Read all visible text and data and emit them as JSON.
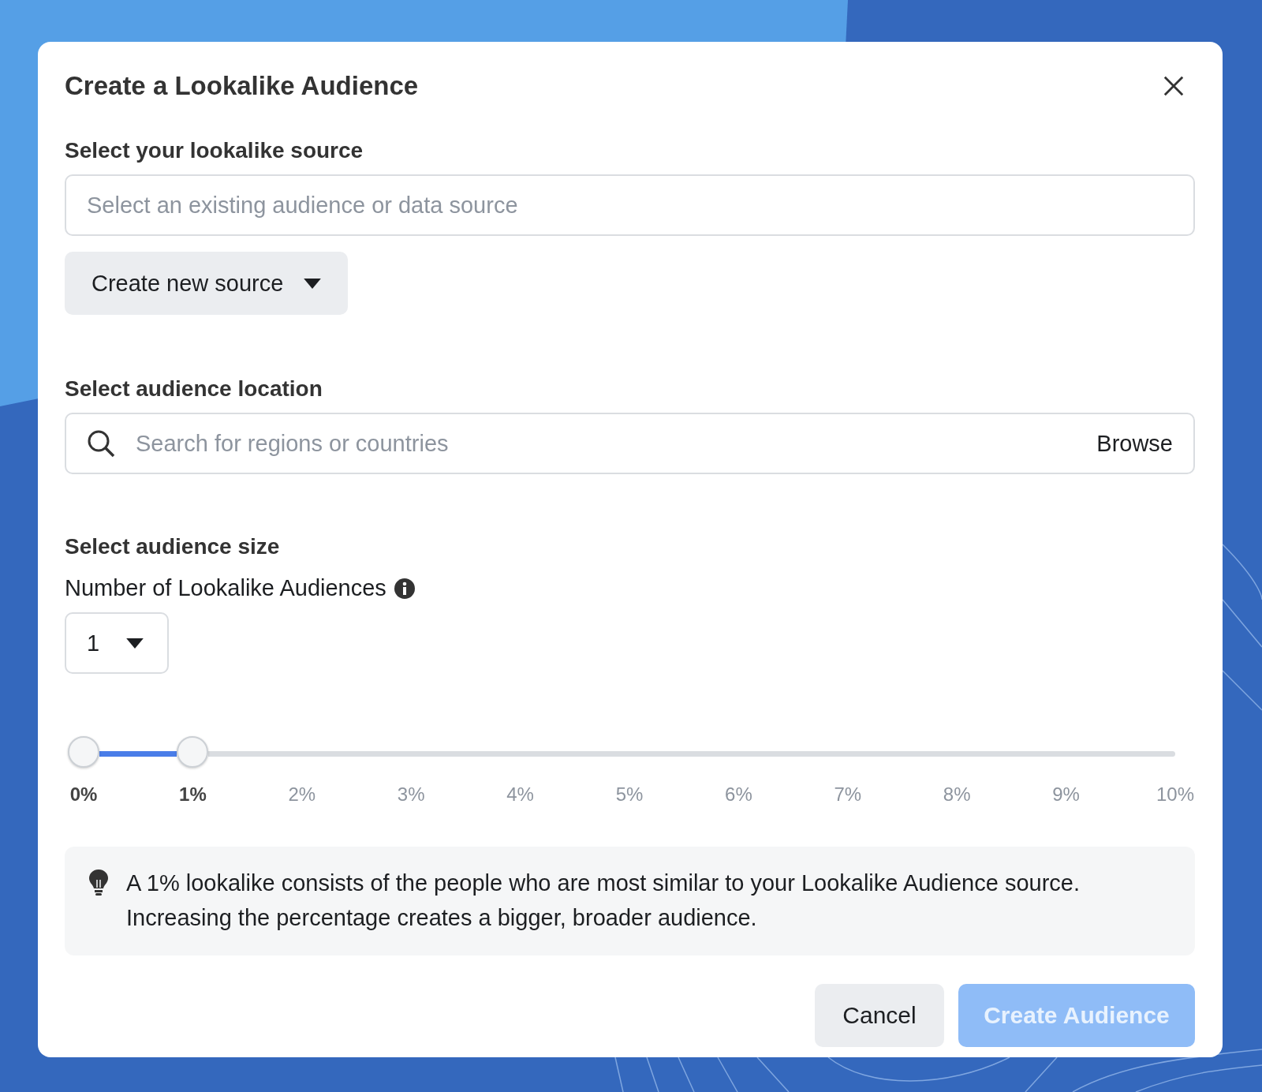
{
  "dialog": {
    "title": "Create a Lookalike Audience"
  },
  "source": {
    "label": "Select your lookalike source",
    "placeholder": "Select an existing audience or data source",
    "create_button": "Create new source"
  },
  "location": {
    "label": "Select audience location",
    "placeholder": "Search for regions or countries",
    "browse": "Browse"
  },
  "size": {
    "label": "Select audience size",
    "count_label": "Number of Lookalike Audiences",
    "count_value": "1",
    "slider": {
      "level": 0.1,
      "ticks": [
        {
          "label": "0%",
          "selected": true
        },
        {
          "label": "1%",
          "selected": true
        },
        {
          "label": "2%",
          "selected": false
        },
        {
          "label": "3%",
          "selected": false
        },
        {
          "label": "4%",
          "selected": false
        },
        {
          "label": "5%",
          "selected": false
        },
        {
          "label": "6%",
          "selected": false
        },
        {
          "label": "7%",
          "selected": false
        },
        {
          "label": "8%",
          "selected": false
        },
        {
          "label": "9%",
          "selected": false
        },
        {
          "label": "10%",
          "selected": false
        }
      ]
    }
  },
  "tip": "A 1% lookalike consists of the people who are most similar to your Lookalike Audience source. Increasing the percentage creates a bigger, broader audience.",
  "buttons": [
    {
      "label": "Cancel",
      "kind": "secondary",
      "disabled": false
    },
    {
      "label": "Create Audience",
      "kind": "primary",
      "disabled": true
    }
  ]
}
